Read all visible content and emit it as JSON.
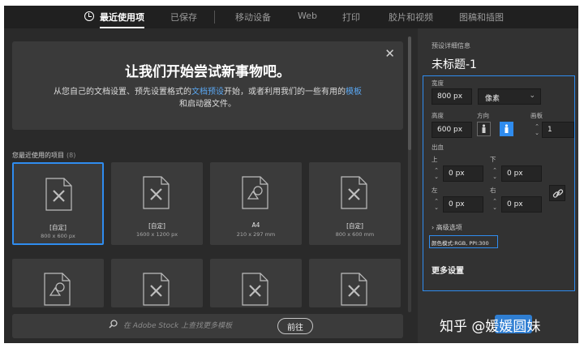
{
  "tabs": [
    {
      "label": "最近使用项",
      "active": true
    },
    {
      "label": "已保存",
      "active": false
    },
    {
      "label": "移动设备",
      "active": false
    },
    {
      "label": "Web",
      "active": false
    },
    {
      "label": "打印",
      "active": false
    },
    {
      "label": "胶片和视频",
      "active": false
    },
    {
      "label": "图稿和插图",
      "active": false
    }
  ],
  "banner": {
    "title": "让我们开始尝试新事物吧。",
    "text_parts": [
      "从您自己的文档设置、预先设置格式的",
      "文档预设",
      "开始，或者利用我们的一些有用的",
      "模板",
      "和启动器文件。"
    ]
  },
  "recent": {
    "heading": "您最近使用的项目",
    "count": "(8)",
    "items": [
      {
        "label": "[自定]",
        "dims": "800 x 600 px",
        "icon": "custom-doc-icon"
      },
      {
        "label": "[自定]",
        "dims": "1600 x 1200 px",
        "icon": "custom-doc-icon"
      },
      {
        "label": "A4",
        "dims": "210 x 297 mm",
        "icon": "print-doc-icon"
      },
      {
        "label": "[自定]",
        "dims": "800 x 600 mm",
        "icon": "custom-doc-icon"
      }
    ],
    "row2_icons": [
      "print-doc-icon",
      "custom-doc-icon",
      "custom-doc-icon",
      "custom-doc-icon"
    ]
  },
  "stock": {
    "placeholder": "在 Adobe Stock 上查找更多模板",
    "button": "前往"
  },
  "preset": {
    "section_label": "预设详细信息",
    "name": "未标题-1",
    "width_label": "宽度",
    "width_value": "800 px",
    "unit": "像素",
    "height_label": "高度",
    "height_value": "600 px",
    "orientation_label": "方向",
    "artboard_label": "画板",
    "artboard_value": "1",
    "bleed_label": "出血",
    "top_label": "上",
    "top_value": "0 px",
    "bottom_label": "下",
    "bottom_value": "0 px",
    "left_label": "左",
    "left_value": "0 px",
    "right_label": "右",
    "right_value": "0 px",
    "advanced": "› 高级选项",
    "color_mode": "颜色模式:RGB, PPI:300",
    "more_settings": "更多设置"
  },
  "watermark": "知乎 @媛媛圆妹",
  "colors": {
    "accent": "#2f8cef",
    "panel": "#323232",
    "background": "#2a2a2a"
  }
}
